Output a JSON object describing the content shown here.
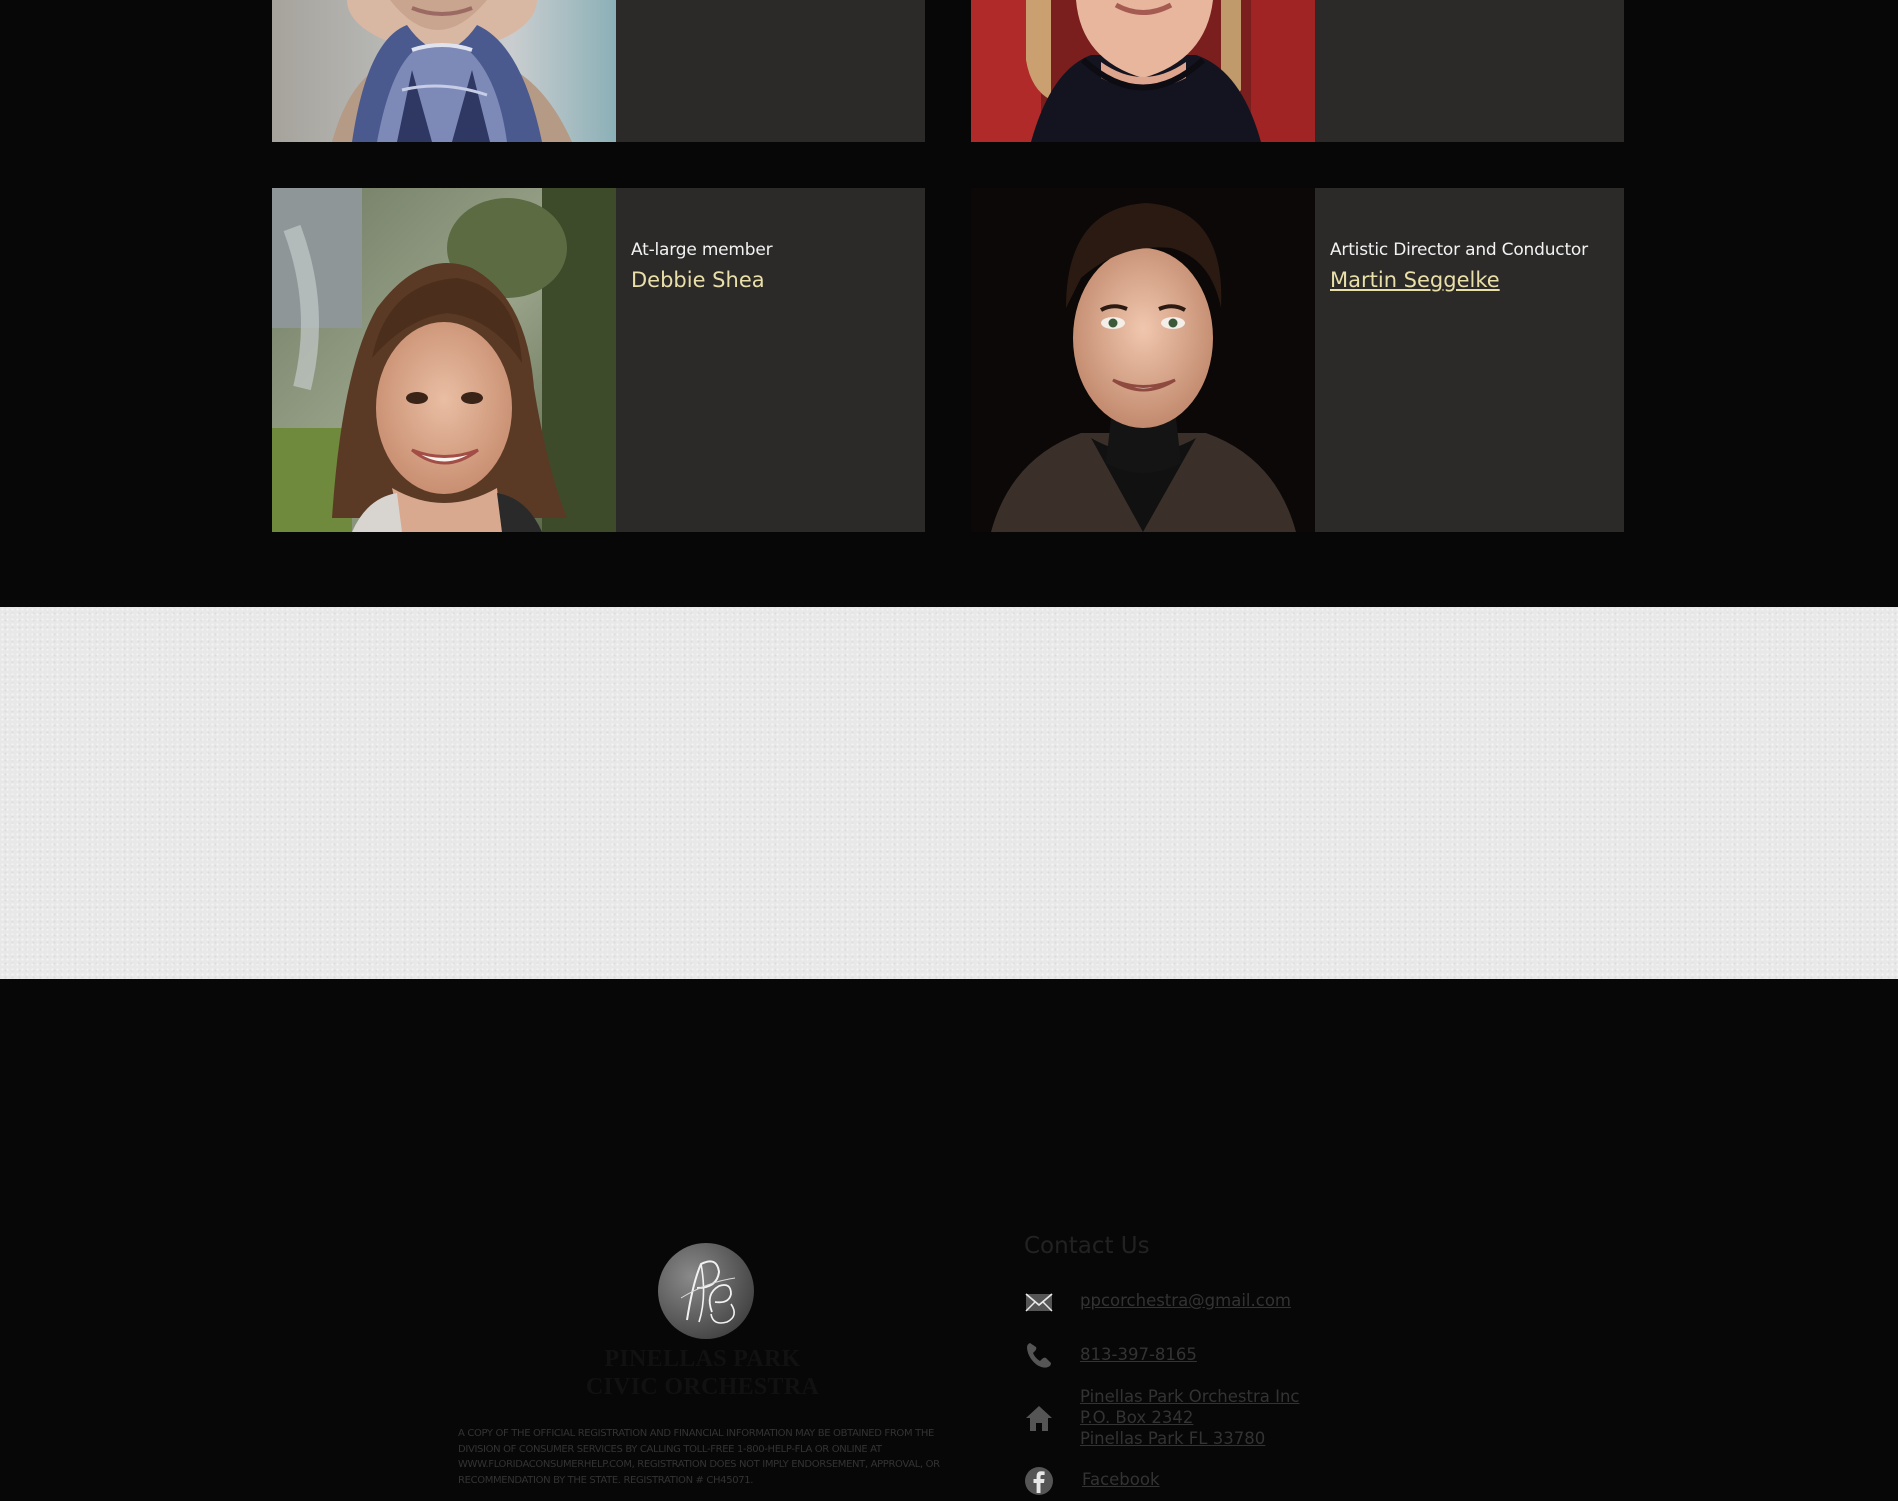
{
  "board": {
    "members": [
      {
        "role": "At-large member",
        "name": "Debbie Shea",
        "photo": "portrait of smiling woman with brown hair outdoors"
      },
      {
        "role": "Artistic Director and Conductor",
        "name": "Martin Seggelke",
        "photo": "portrait of smiling man in dark jacket"
      }
    ]
  },
  "footer": {
    "logo": {
      "monogram": "PPCO",
      "line1": "PINELLAS PARK",
      "line2": "CIVIC ORCHESTRA"
    },
    "disclaimer": "A copy of the official registration and financial information may be obtained from the Division of Consumer Services by calling toll-free 1-800-HELP-FLA or online at www.FloridaConsumerHelp.com, registration does not imply endorsement, approval, or recommendation by the state. Registration # CH45071.",
    "contact": {
      "title": "Contact Us",
      "email": "ppcorchestra@gmail.com",
      "phone": "813-397-8165",
      "address_line1": "Pinellas Park Orchestra Inc",
      "address_line2": "P.O. Box 2342",
      "address_line3": "Pinellas Park FL 33780",
      "facebook": "Facebook",
      "icons": [
        "envelope-icon",
        "phone-icon",
        "home-icon",
        "facebook-icon"
      ]
    }
  },
  "colors": {
    "card_bg": "#2b2a29",
    "name_accent": "#e9dfa9",
    "page_bg": "#070707",
    "footer_bg": "#e8e8e8"
  }
}
